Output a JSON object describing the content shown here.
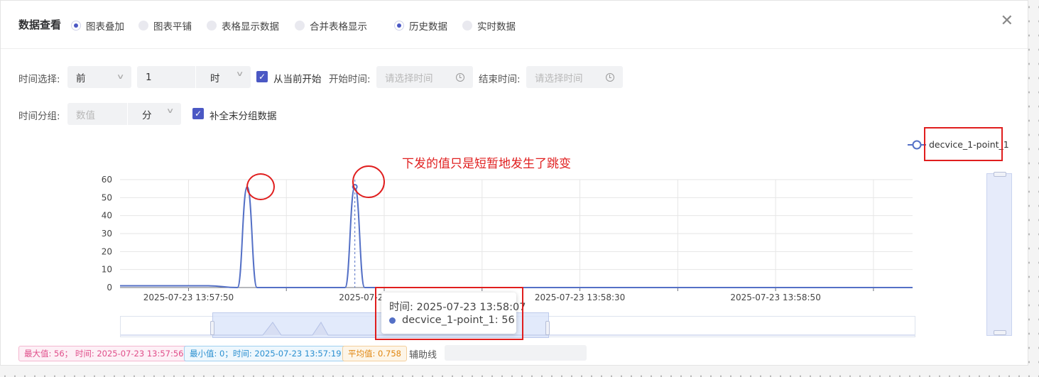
{
  "dialog": {
    "title": "数据查看",
    "close_icon": "close-icon",
    "view_modes": [
      {
        "label": "图表叠加",
        "selected": true
      },
      {
        "label": "图表平铺",
        "selected": false
      },
      {
        "label": "表格显示数据",
        "selected": false
      },
      {
        "label": "合并表格显示",
        "selected": false
      }
    ],
    "data_modes": [
      {
        "label": "历史数据",
        "selected": true
      },
      {
        "label": "实时数据",
        "selected": false
      }
    ]
  },
  "filters": {
    "time_select_label": "时间选择:",
    "relative_value": "前",
    "amount_value": "1",
    "unit_value": "时",
    "from_now_label": "从当前开始",
    "from_now_checked": true,
    "start_label": "开始时间:",
    "start_placeholder": "请选择时间",
    "end_label": "结束时间:",
    "end_placeholder": "请选择时间",
    "group_label": "时间分组:",
    "group_value_placeholder": "数值",
    "group_unit_value": "分",
    "fill_last_label": "补全末分组数据",
    "fill_last_checked": true
  },
  "annotation": {
    "text": "下发的值只是短暂地发生了跳变"
  },
  "chart_data": {
    "type": "line",
    "series": [
      {
        "name": "decvice_1-point_1",
        "color": "#5470c6",
        "x": [
          "2025-07-23 13:57:43",
          "2025-07-23 13:57:52",
          "2025-07-23 13:57:55",
          "2025-07-23 13:57:56",
          "2025-07-23 13:57:57",
          "2025-07-23 13:57:58",
          "2025-07-23 13:58:03",
          "2025-07-23 13:58:06",
          "2025-07-23 13:58:07",
          "2025-07-23 13:58:08",
          "2025-07-23 13:59:04"
        ],
        "values": [
          1,
          1,
          0,
          56,
          0,
          0,
          0,
          0,
          56,
          0,
          0
        ]
      }
    ],
    "x_ticks": [
      "2025-07-23 13:57:50",
      "2025-07-23 13:58:10",
      "2025-07-23 13:58:30",
      "2025-07-23 13:58:50"
    ],
    "x_range": [
      "2025-07-23 13:57:43",
      "2025-07-23 13:59:04"
    ],
    "y_ticks": [
      0,
      10,
      20,
      30,
      40,
      50,
      60
    ],
    "ylim": [
      0,
      60
    ],
    "grid": true,
    "legend": "top-right"
  },
  "tooltip": {
    "time_line": "时间: 2025-07-23 13:58:07",
    "series_line": "decvice_1-point_1: 56"
  },
  "stats": {
    "max": "最大值: 56； 时间: 2025-07-23 13:57:56",
    "min": "最小值: 0；时间: 2025-07-23 13:57:19",
    "avg": "平均值: 0.758"
  },
  "aux_line": {
    "label": "辅助线",
    "value": ""
  }
}
